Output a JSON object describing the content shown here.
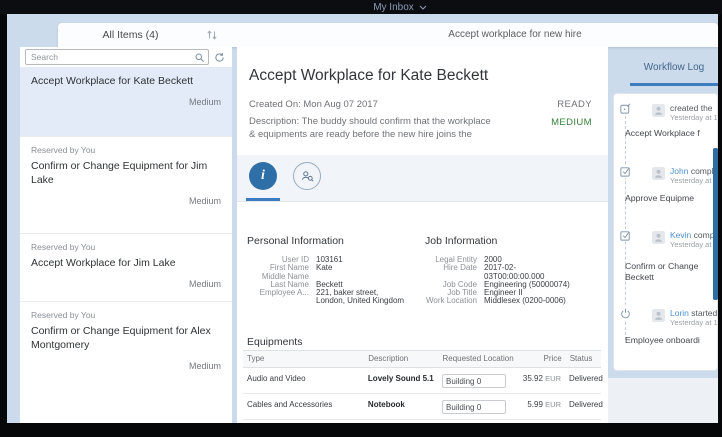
{
  "shell": {
    "title": "My Inbox"
  },
  "page_header": {
    "master_title": "All Items (4)",
    "detail_title": "Accept workplace for new hire"
  },
  "master": {
    "search_placeholder": "Search",
    "items": [
      {
        "reserved": "",
        "title": "Accept Workplace for Kate Beckett",
        "priority": "Medium",
        "selected": true
      },
      {
        "reserved": "Reserved by You",
        "title": "Confirm or Change Equipment for Jim Lake",
        "priority": "Medium",
        "selected": false
      },
      {
        "reserved": "Reserved by You",
        "title": "Accept Workplace for Jim Lake",
        "priority": "Medium",
        "selected": false
      },
      {
        "reserved": "Reserved by You",
        "title": "Confirm or Change Equipment for Alex Montgomery",
        "priority": "Medium",
        "selected": false
      }
    ]
  },
  "detail": {
    "title": "Accept Workplace for Kate Beckett",
    "created_on": "Created On: Mon Aug 07 2017",
    "status": "READY",
    "priority": "MEDIUM",
    "description": [
      "Description: The buddy should confirm that the workplace",
      "& equipments are ready before the new hire joins the"
    ],
    "personal": {
      "heading": "Personal Information",
      "rows": [
        {
          "label": "User ID",
          "value": "103161"
        },
        {
          "label": "First Name",
          "value": "Kate"
        },
        {
          "label": "Middle Name",
          "value": ""
        },
        {
          "label": "Last Name",
          "value": "Beckett"
        },
        {
          "label": "Employee A...",
          "value": "221, baker street,",
          "value2": "London, United Kingdom"
        }
      ]
    },
    "job": {
      "heading": "Job Information",
      "rows": [
        {
          "label": "Legal Entity",
          "value": "2000"
        },
        {
          "label": "Hire Date",
          "value": "2017-02-",
          "value2": "03T00:00:00.000"
        },
        {
          "label": "Job Code",
          "value": "Engineering (50000074)"
        },
        {
          "label": "Job Title",
          "value": "Engineer II"
        },
        {
          "label": "Work Location",
          "value": "Middlesex (0200-0006)"
        }
      ]
    },
    "equipments": {
      "heading": "Equipments",
      "columns": [
        "Type",
        "Description",
        "Requested Location",
        "Price",
        "Status"
      ],
      "rows": [
        {
          "type": "Audio and Video",
          "description": "Lovely Sound 5.1",
          "location": "Building 0",
          "price": "35.92",
          "currency": "EUR",
          "status": "Delivered"
        },
        {
          "type": "Cables and Accessories",
          "description": "Notebook",
          "location": "Building 0",
          "price": "5.99",
          "currency": "EUR",
          "status": "Delivered"
        }
      ]
    }
  },
  "workflow": {
    "tab_label": "Workflow Log",
    "entries": [
      {
        "actor": "",
        "action": "created the",
        "time": "Yesterday at 1",
        "body": "Accept Workplace f",
        "body2": ""
      },
      {
        "actor": "John",
        "action": "comple",
        "time": "Yesterday at 1",
        "body": "Approve Equipme",
        "body2": ""
      },
      {
        "actor": "Kevin",
        "action": "comp",
        "time": "Yesterday at 1",
        "body": "Confirm or Change",
        "body2": "Beckett"
      },
      {
        "actor": "Lorin",
        "action": "started",
        "time": "Yesterday at 1",
        "body": "Employee onboardi",
        "body2": ""
      }
    ]
  },
  "colors": {
    "app_background": "#cbdbec",
    "selected_item": "#e2ebf7",
    "accent_blue": "#3f7bbf",
    "link_blue": "#4f90d0",
    "priority_green": "#35803a",
    "info_tab_circle": "#2f6fa8",
    "right_scrollbar": "#2e6da4"
  }
}
